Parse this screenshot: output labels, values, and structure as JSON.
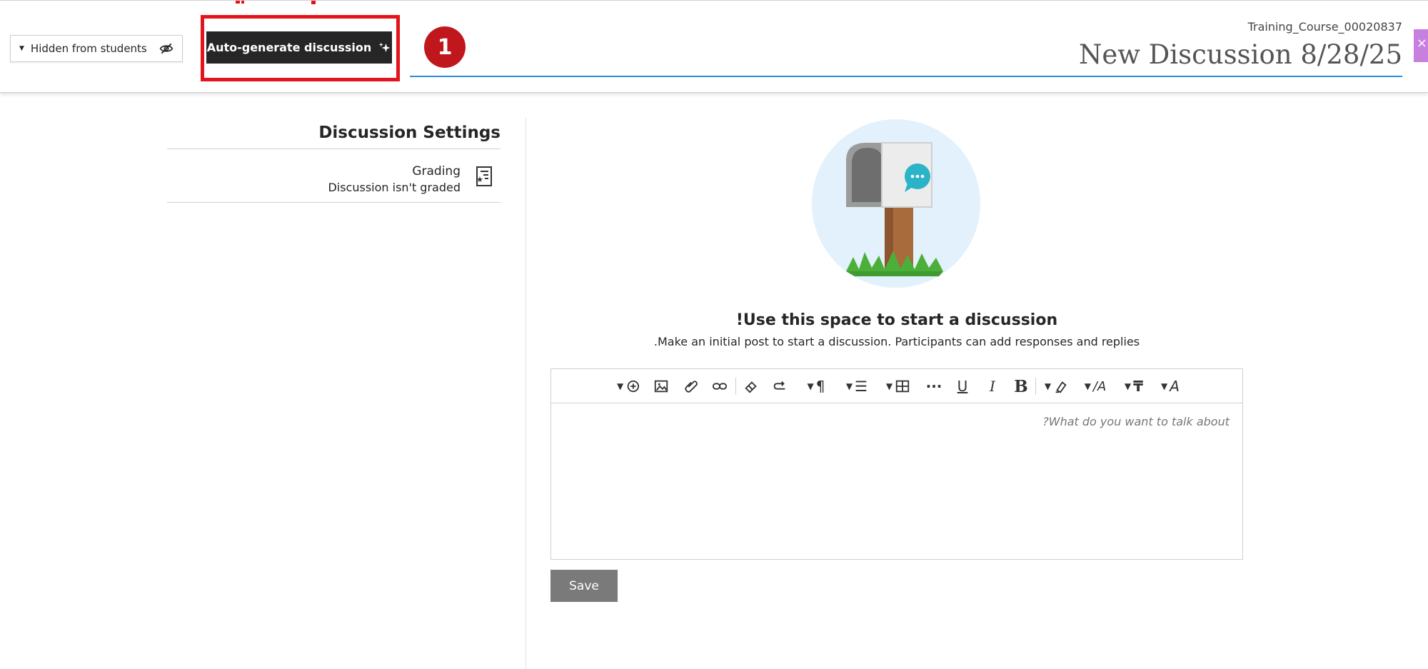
{
  "header": {
    "visibility_label": "Hidden from students",
    "autogen_label": "Auto-generate discussion",
    "step_number": "1",
    "course_name": "Training_Course_00020837",
    "title": "New Discussion 8/28/25"
  },
  "settings": {
    "title": "Discussion Settings",
    "grading_label": "Grading",
    "grading_status": "Discussion isn't graded"
  },
  "main": {
    "heading": "!Use this space to start a discussion",
    "subtext": ".Make an initial post to start a discussion. Participants can add responses and replies"
  },
  "editor": {
    "placeholder": "?What do you want to talk about",
    "toolbar_icons": [
      "insert-content-icon",
      "image-icon",
      "attach-icon",
      "link-icon",
      "clear-format-icon",
      "redo-icon",
      "paragraph-icon",
      "align-icon",
      "table-icon",
      "more-icon",
      "underline-icon",
      "italic-icon",
      "bold-icon",
      "highlight-icon",
      "font-size-icon",
      "text-style-icon",
      "text-color-icon"
    ]
  },
  "actions": {
    "save_label": "Save"
  },
  "colors": {
    "highlight_red": "#e3141b",
    "badge_red": "#c0171d",
    "title_underline": "#2a8ad8",
    "button_dark": "#262626",
    "save_gray": "#7a7a7a"
  }
}
